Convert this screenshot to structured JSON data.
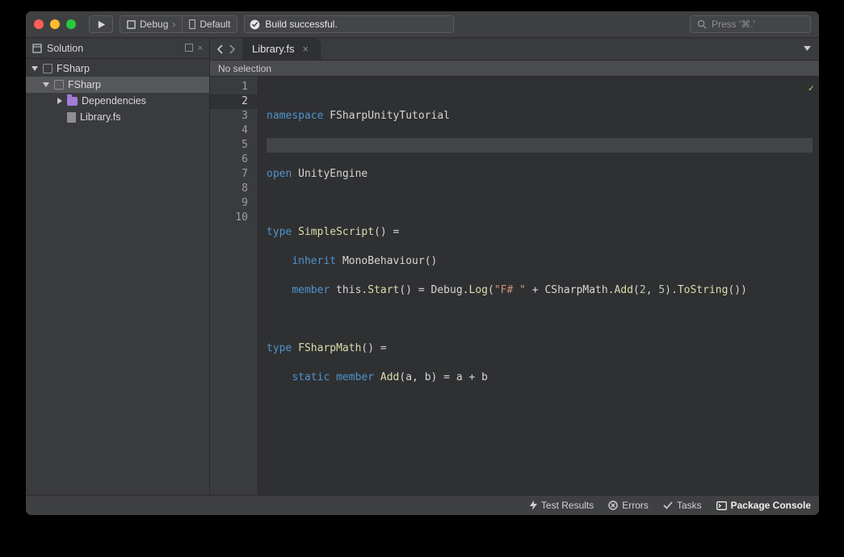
{
  "toolbar": {
    "config_label": "Debug",
    "target_label": "Default",
    "status_text": "Build successful.",
    "search_placeholder": "Press '⌘.'"
  },
  "sidebar": {
    "title": "Solution",
    "items": [
      {
        "label": "FSharp"
      },
      {
        "label": "FSharp"
      },
      {
        "label": "Dependencies"
      },
      {
        "label": "Library.fs"
      }
    ]
  },
  "editor": {
    "tab_label": "Library.fs",
    "breadcrumb": "No selection",
    "lines": [
      "1",
      "2",
      "3",
      "4",
      "5",
      "6",
      "7",
      "8",
      "9",
      "10"
    ],
    "code": {
      "l1_kw": "namespace",
      "l1_ns": "FSharpUnityTutorial",
      "l3_kw": "open",
      "l3_mod": "UnityEngine",
      "l5_kw": "type",
      "l5_t": "SimpleScript",
      "l5_eq": "() =",
      "l6_kw": "inherit",
      "l6_base": "MonoBehaviour",
      "l6_p": "()",
      "l7_kw": "member",
      "l7_this": "this",
      "l7_start": "Start",
      "l7_unit": "()",
      "l7_eq": " = ",
      "l7_debug": "Debug",
      "l7_log": "Log",
      "l7_lp": "(",
      "l7_str": "\"F# \"",
      "l7_plus": " + ",
      "l7_cm": "CSharpMath",
      "l7_add": "Add",
      "l7_args_open": "(",
      "l7_n1": "2",
      "l7_c": ", ",
      "l7_n2": "5",
      "l7_args_close": ")",
      "l7_dot_ts": ".",
      "l7_ts": "ToString",
      "l7_ts_p": "()",
      "l7_rp": ")",
      "l9_kw": "type",
      "l9_t": "FSharpMath",
      "l9_eq": "() =",
      "l10_kw1": "static",
      "l10_kw2": "member",
      "l10_add": "Add",
      "l10_ab": "(a, b) = a + b"
    }
  },
  "statusbar": {
    "test": "Test Results",
    "errors": "Errors",
    "tasks": "Tasks",
    "package": "Package Console"
  }
}
